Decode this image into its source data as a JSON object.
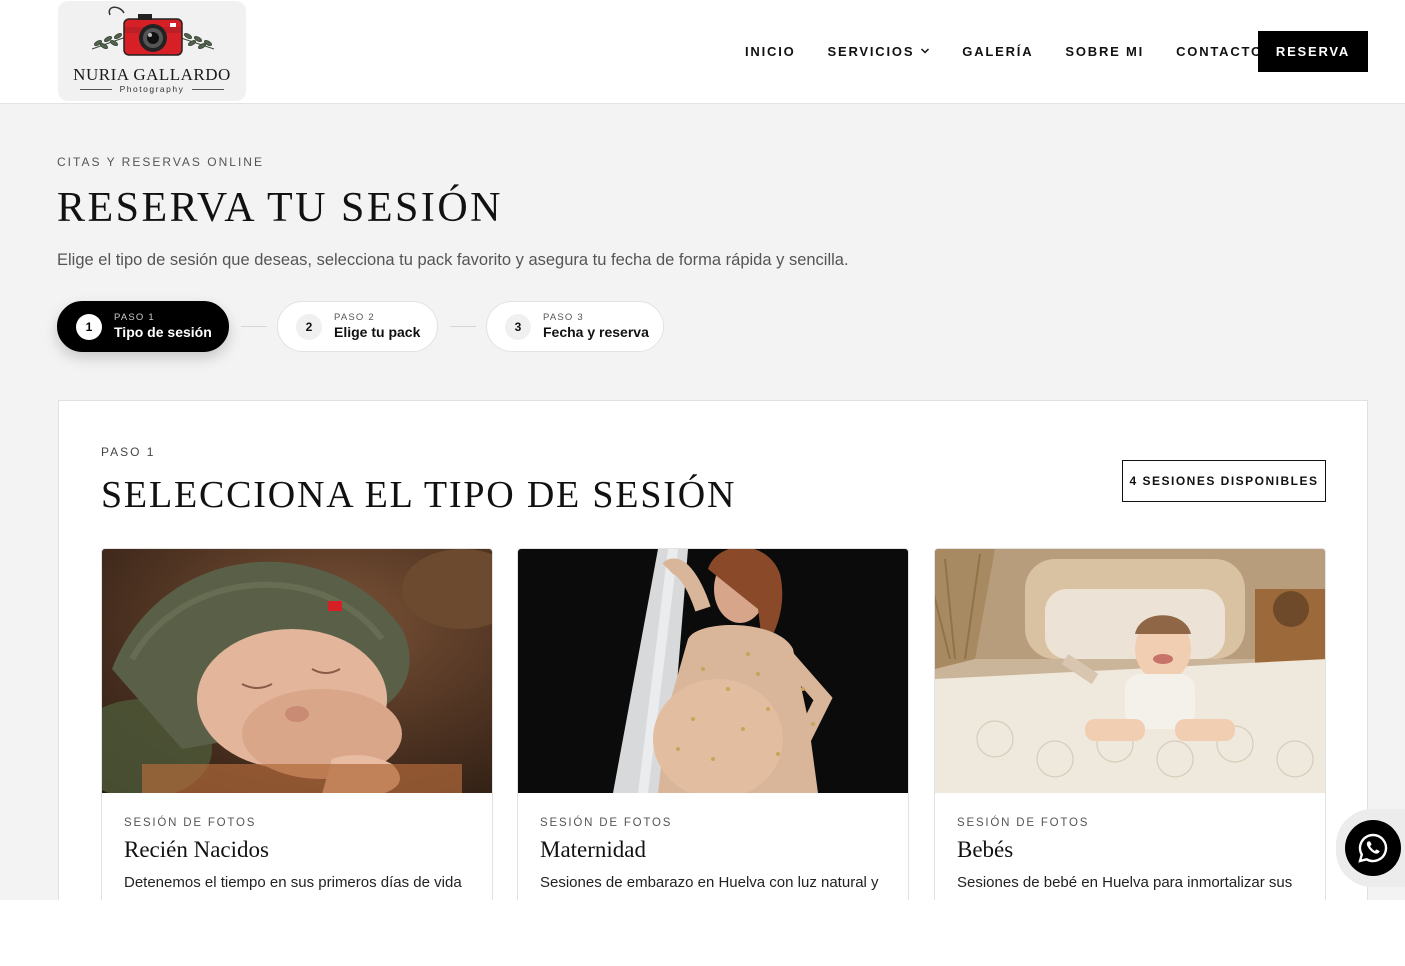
{
  "header": {
    "logo": {
      "name": "NURIA GALLARDO",
      "sub": "Photography"
    },
    "nav": [
      {
        "label": "INICIO"
      },
      {
        "label": "SERVICIOS"
      },
      {
        "label": "GALERÍA"
      },
      {
        "label": "SOBRE MI"
      },
      {
        "label": "CONTACTO"
      }
    ],
    "cta": "RESERVA"
  },
  "hero": {
    "eyebrow": "CITAS Y RESERVAS ONLINE",
    "title": "RESERVA TU SESIÓN",
    "subtitle": "Elige el tipo de sesión que deseas, selecciona tu pack favorito y asegura tu fecha de forma rápida y sencilla."
  },
  "steps": [
    {
      "num": "1",
      "small": "PASO 1",
      "label": "Tipo de sesión",
      "active": true
    },
    {
      "num": "2",
      "small": "PASO 2",
      "label": "Elige tu pack",
      "active": false
    },
    {
      "num": "3",
      "small": "PASO 3",
      "label": "Fecha y reserva",
      "active": false
    }
  ],
  "panel": {
    "eyebrow": "PASO 1",
    "title": "SELECCIONA EL TIPO DE SESIÓN",
    "badge": "4 SESIONES DISPONIBLES",
    "cards": [
      {
        "eyebrow": "SESIÓN DE FOTOS",
        "title": "Recién Nacidos",
        "desc": "Detenemos el tiempo en sus primeros días de vida"
      },
      {
        "eyebrow": "SESIÓN DE FOTOS",
        "title": "Maternidad",
        "desc": "Sesiones de embarazo en Huelva con luz natural y"
      },
      {
        "eyebrow": "SESIÓN DE FOTOS",
        "title": "Bebés",
        "desc": "Sesiones de bebé en Huelva para inmortalizar sus"
      }
    ]
  },
  "icons": {
    "whatsapp": "whatsapp-icon",
    "dropdown": "chevron-down-icon",
    "logo_camera": "camera-icon"
  },
  "colors": {
    "primary": "#000000",
    "background": "#f3f3f3",
    "logo_accent": "#d71f26"
  }
}
